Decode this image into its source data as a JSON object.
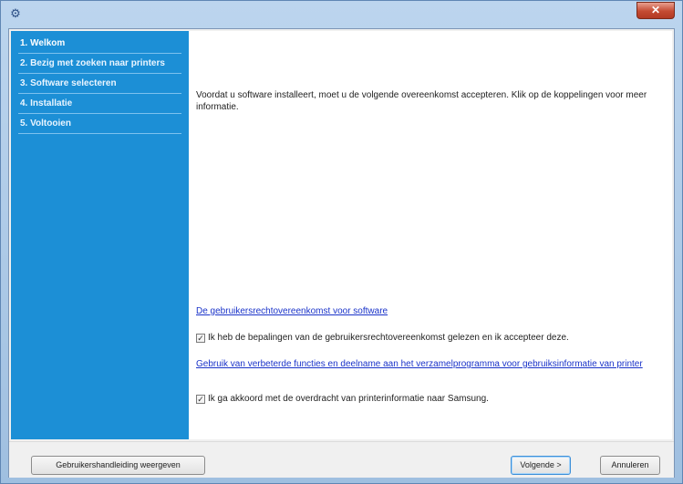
{
  "window": {
    "close_label": "✕"
  },
  "sidebar": {
    "steps": [
      {
        "label": "1. Welkom"
      },
      {
        "label": "2. Bezig met zoeken naar printers"
      },
      {
        "label": "3. Software selecteren"
      },
      {
        "label": "4. Installatie"
      },
      {
        "label": "5. Voltooien"
      }
    ]
  },
  "content": {
    "intro": "Voordat u software installeert, moet u de volgende overeenkomst accepteren. Klik op de koppelingen voor meer informatie.",
    "license_link": "De gebruikersrechtovereenkomst voor software",
    "license_check_label": "Ik heb de bepalingen van de gebruikersrechtovereenkomst gelezen en ik accepteer deze.",
    "license_checked": true,
    "improvement_link": "Gebruik van verbeterde functies en deelname aan het verzamelprogramma voor gebruiksinformatie van printer",
    "transfer_check_label": "Ik ga akkoord met de overdracht van printerinformatie naar Samsung.",
    "transfer_checked": true
  },
  "buttons": {
    "manual": "Gebruikershandleiding weergeven",
    "next": "Volgende >",
    "cancel": "Annuleren"
  },
  "colors": {
    "sidebar": "#1c8fd6",
    "link": "#1a33c9",
    "close": "#c44a32"
  },
  "icons": {
    "check": "✓"
  }
}
